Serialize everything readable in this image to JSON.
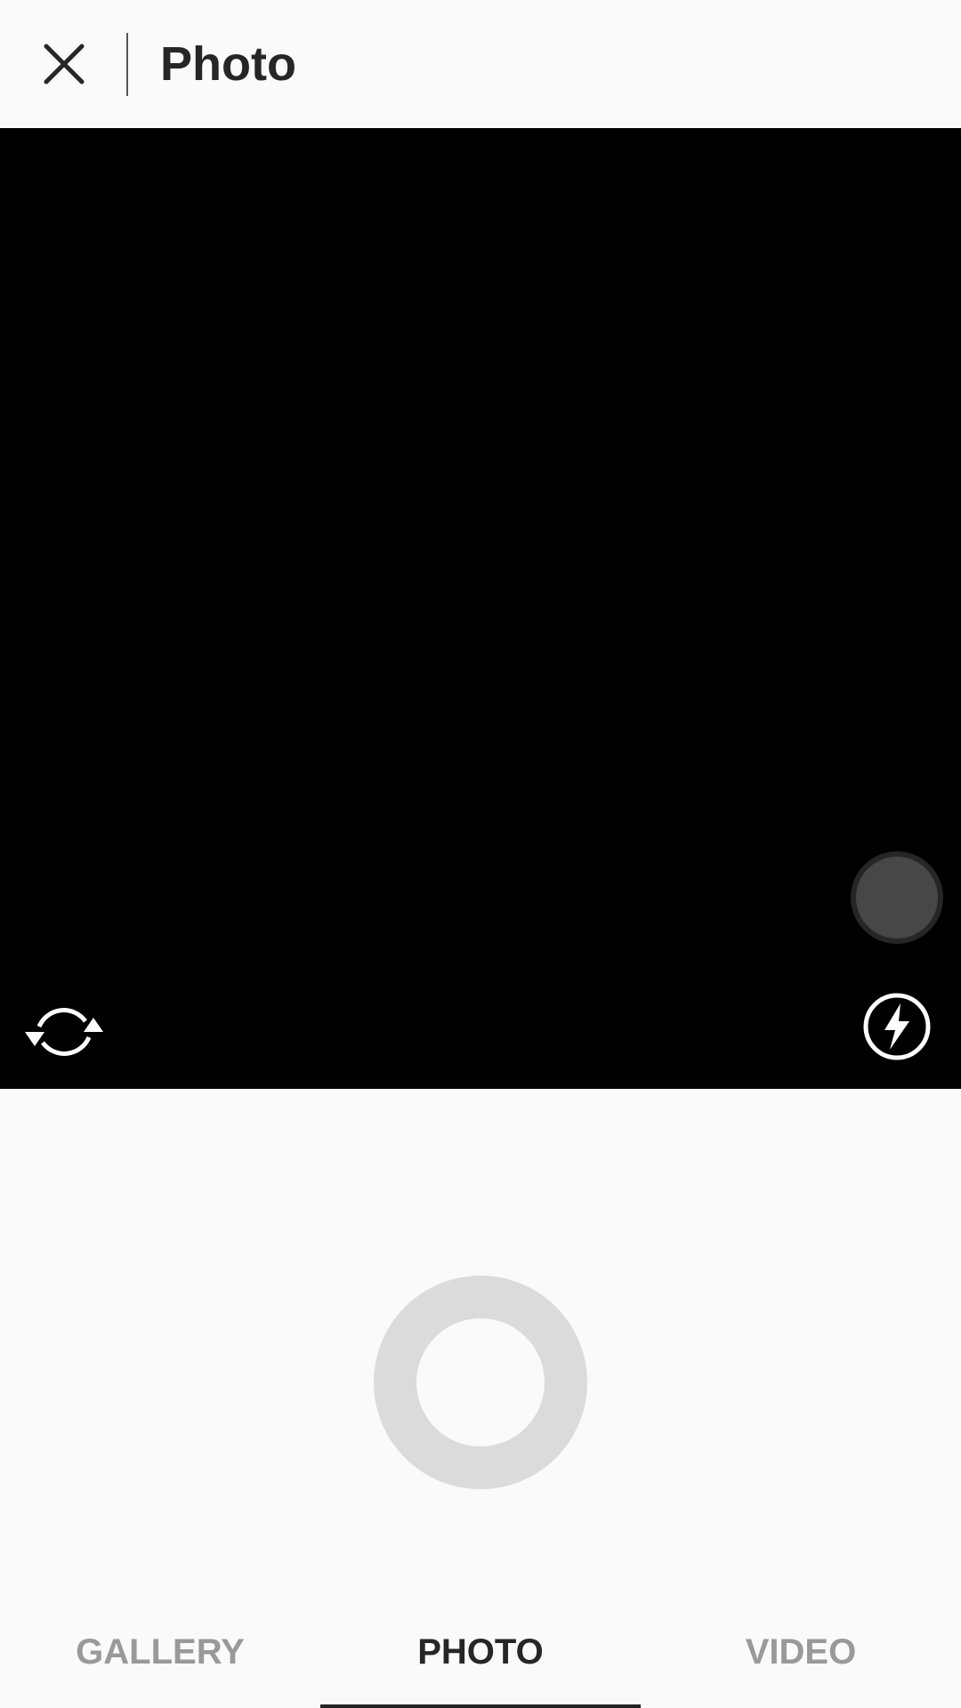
{
  "header": {
    "title": "Photo"
  },
  "tabs": [
    {
      "label": "GALLERY",
      "active": false
    },
    {
      "label": "PHOTO",
      "active": true
    },
    {
      "label": "VIDEO",
      "active": false
    }
  ],
  "icons": {
    "close": "close-icon",
    "switch_camera": "switch-camera-icon",
    "flash": "flash-icon"
  },
  "colors": {
    "background": "#fafafa",
    "viewfinder": "#000000",
    "text_primary": "#262626",
    "text_inactive": "#999999",
    "shutter_ring": "#dbdbdb"
  }
}
